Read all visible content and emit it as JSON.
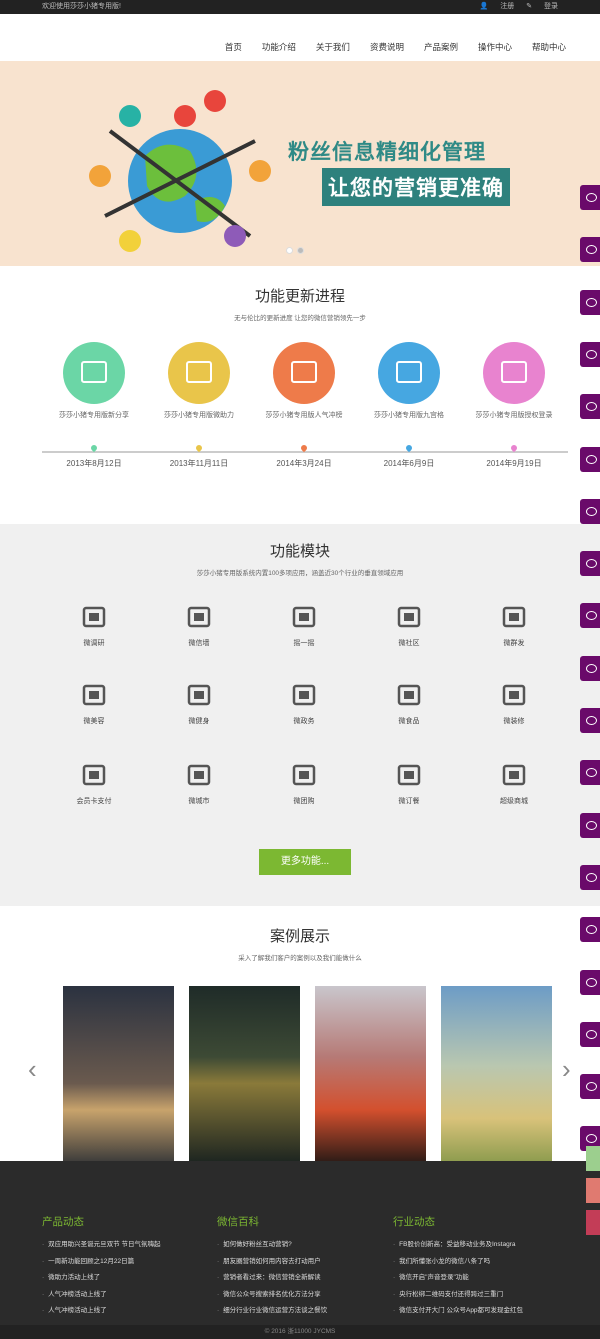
{
  "topbar": {
    "welcome": "欢迎使用莎莎小猪专用版!",
    "register": "注册",
    "login": "登录"
  },
  "nav": [
    "首页",
    "功能介绍",
    "关于我们",
    "资费说明",
    "产品案例",
    "操作中心",
    "帮助中心"
  ],
  "hero": {
    "line1": "粉丝信息精细化管理",
    "line2": "让您的营销更准确"
  },
  "updates": {
    "title": "功能更新进程",
    "subtitle": "无与伦比的更新进度 让您的微信营销领先一步",
    "items": [
      {
        "label": "莎莎小猪专用版新分享",
        "date": "2013年8月12日",
        "color": "#6bd6a6"
      },
      {
        "label": "莎莎小猪专用版微助力",
        "date": "2013年11月11日",
        "color": "#e9c54a"
      },
      {
        "label": "莎莎小猪专用版人气冲榜",
        "date": "2014年3月24日",
        "color": "#ee7b4a"
      },
      {
        "label": "莎莎小猪专用版九宫格",
        "date": "2014年6月9日",
        "color": "#46a7e1"
      },
      {
        "label": "莎莎小猪专用版授权登录",
        "date": "2014年9月19日",
        "color": "#e883cf"
      }
    ]
  },
  "modules": {
    "title": "功能模块",
    "subtitle": "莎莎小猪专用版系统内置100多项应用，涵盖近30个行业的垂直领域应用",
    "items": [
      "微调研",
      "微信墙",
      "摇一摇",
      "微社区",
      "微群发",
      "微美容",
      "微健身",
      "微政务",
      "微食品",
      "微装修",
      "会员卡支付",
      "微城市",
      "微团购",
      "微订餐",
      "超级商城"
    ],
    "more": "更多功能..."
  },
  "cases": {
    "title": "案例展示",
    "subtitle": "采入了解我们客户的案例以及我们能做什么"
  },
  "footer": {
    "cols": [
      {
        "title": "产品动态",
        "items": [
          "双应用助兴圣诞元旦双节 节日气氛嗨起",
          "一周新功能回顾之12月22日篇",
          "微助力活动上线了",
          "人气冲榜活动上线了",
          "人气冲榜活动上线了"
        ]
      },
      {
        "title": "微信百科",
        "items": [
          "如何做好粉丝互动营销?",
          "朋友圈营销如何用内容去打动用户",
          "营销者看过来：微信营销全新解读",
          "微信公众号搜索排名优化方法分享",
          "细分行业行业微信运营方法谈之餐饮"
        ]
      },
      {
        "title": "行业动态",
        "items": [
          "FB股价创新高：受益移动业务及Instagra",
          "我们所懂张小龙的微信八条了吗",
          "微信开启\"声音登录\"功能",
          "央行松绑二维码支付还得跨过三重门",
          "微信支付开大门 公众号App都可发现金红包"
        ]
      }
    ],
    "copyright": "© 2016 浙11000 JYCMS"
  }
}
